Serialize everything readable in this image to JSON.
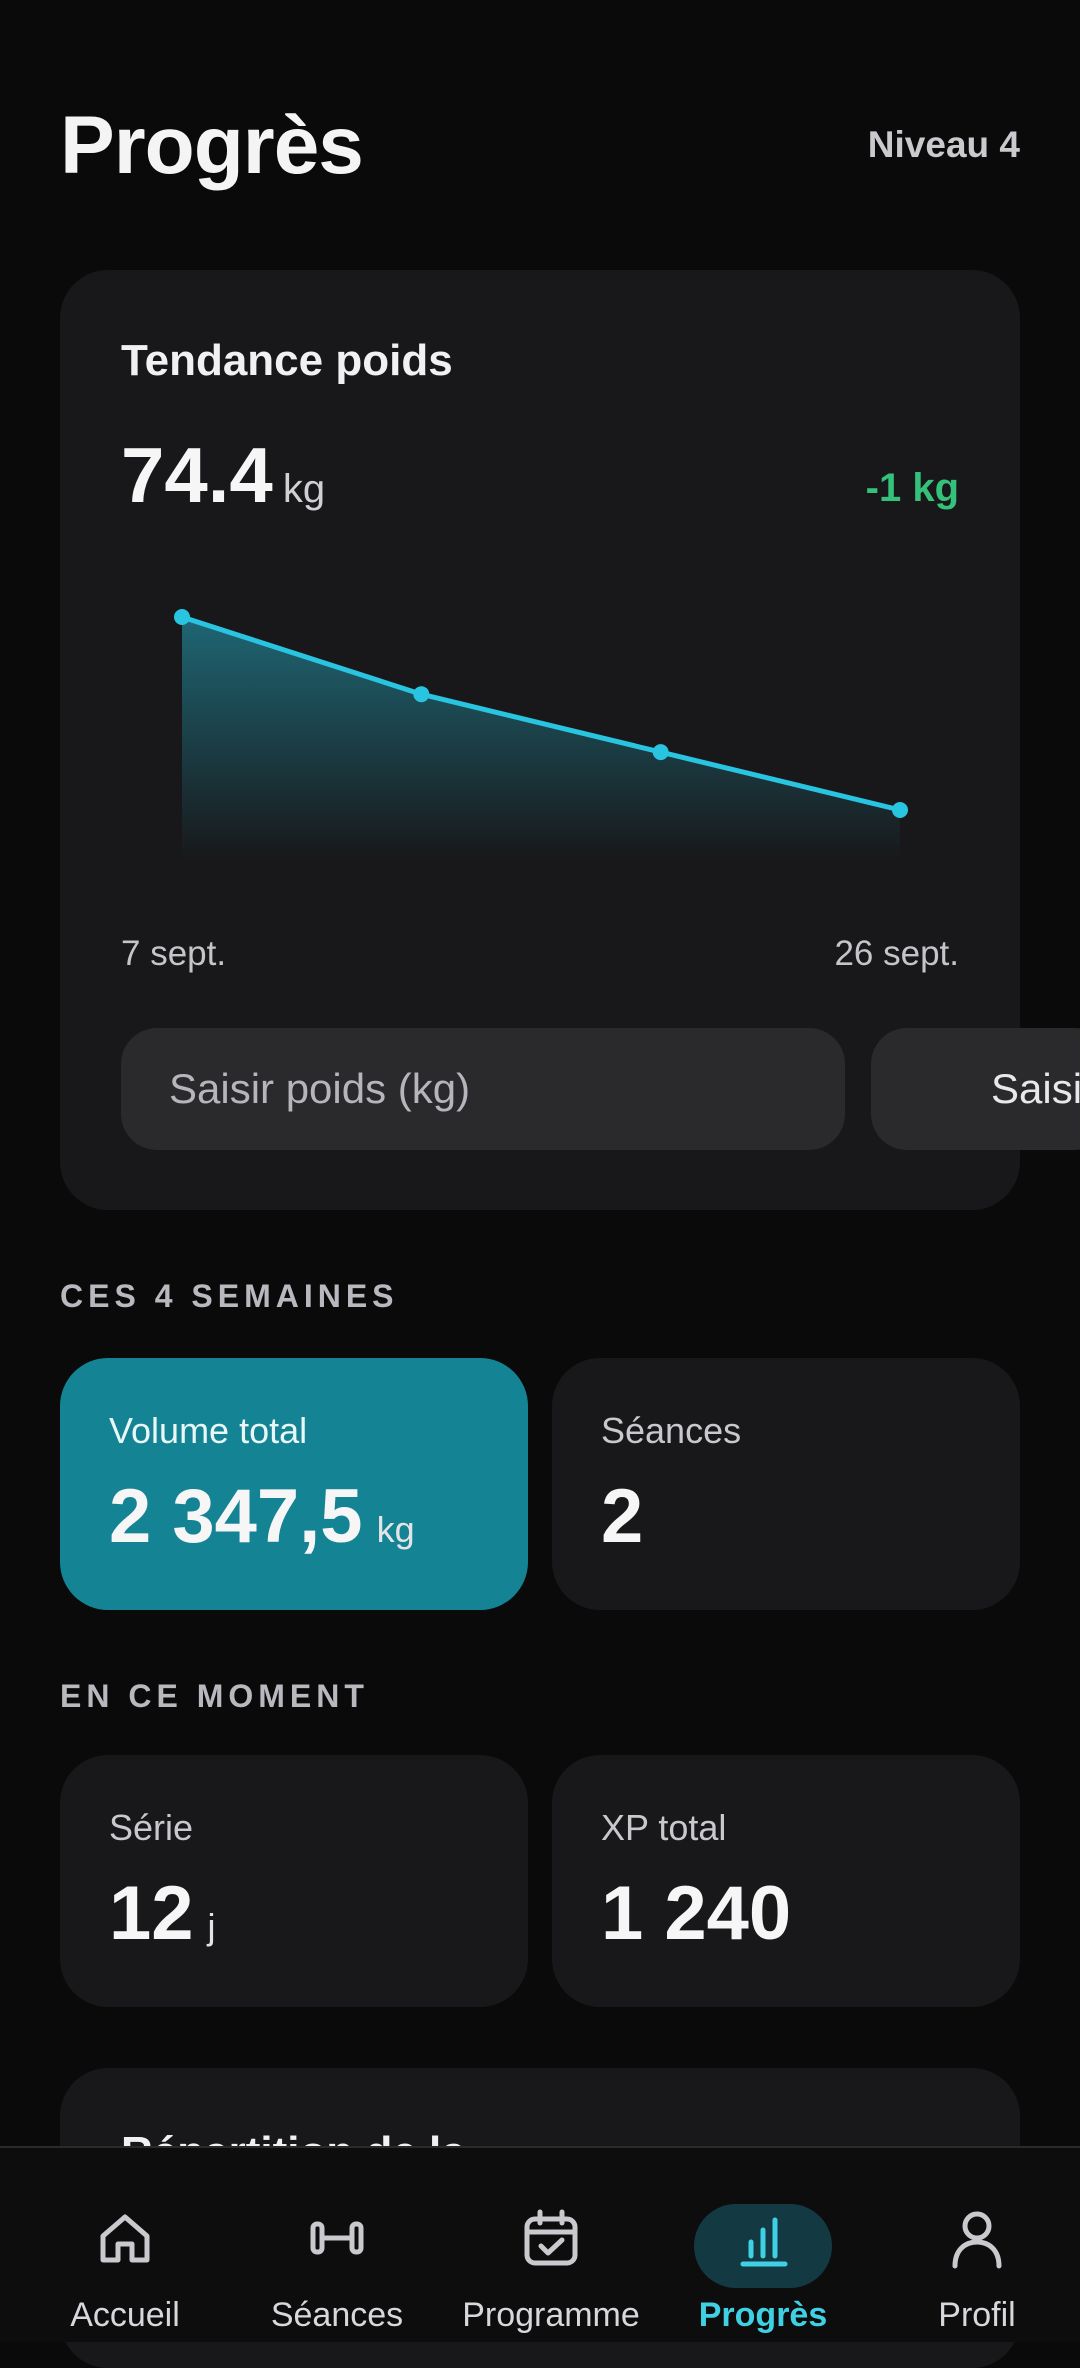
{
  "header": {
    "title": "Progrès",
    "level": "Niveau 4"
  },
  "weight_card": {
    "title": "Tendance poids",
    "current_value": "74.4",
    "unit": "kg",
    "delta": "-1 kg",
    "date_start": "7 sept.",
    "date_end": "26 sept.",
    "input_placeholder": "Saisir poids (kg)",
    "save_label": "Saisir"
  },
  "chart_data": {
    "type": "area",
    "x": [
      "7 sept.",
      "",
      "",
      "26 sept."
    ],
    "series": [
      {
        "values": [
          75.4,
          75.0,
          74.7,
          74.4
        ]
      }
    ],
    "colors": {
      "line": "#29c4df",
      "fill": "#1f6f7e"
    }
  },
  "four_weeks": {
    "label": "CES 4 SEMAINES",
    "volume": {
      "label": "Volume total",
      "value": "2 347,5",
      "unit": "kg"
    },
    "sessions": {
      "label": "Séances",
      "value": "2"
    }
  },
  "right_now": {
    "label": "EN CE MOMENT",
    "streak": {
      "label": "Série",
      "value": "12",
      "unit": "j"
    },
    "xp": {
      "label": "XP total",
      "value": "1 240"
    }
  },
  "next_card": {
    "title": "Répartition de la"
  },
  "tabs": [
    {
      "label": "Accueil",
      "icon": "home-icon"
    },
    {
      "label": "Séances",
      "icon": "dumbbell-icon"
    },
    {
      "label": "Programme",
      "icon": "calendar-check-icon"
    },
    {
      "label": "Progrès",
      "icon": "bar-chart-icon",
      "active": true
    },
    {
      "label": "Profil",
      "icon": "user-icon"
    }
  ],
  "colors": {
    "accent": "#29c4df",
    "accent_card": "#148494",
    "positive": "#34c27a"
  }
}
